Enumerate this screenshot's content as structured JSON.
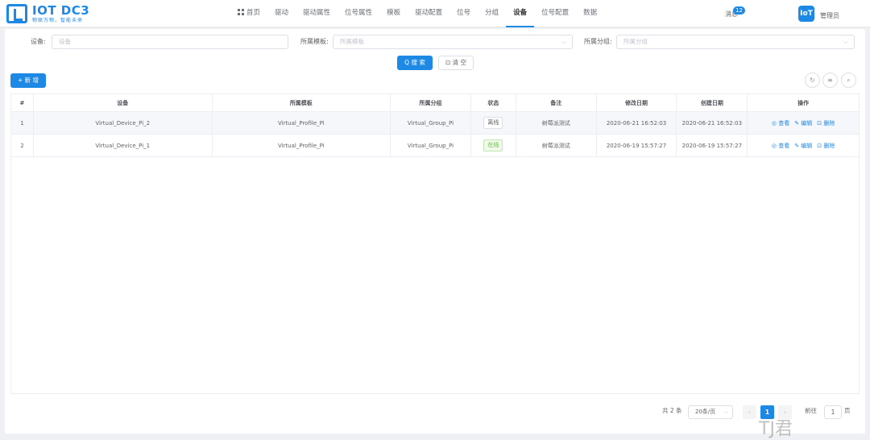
{
  "app": {
    "logo_title": "IOT DC3",
    "logo_subtitle": "物联万物，智能未来"
  },
  "nav": {
    "items": [
      "首页",
      "驱动",
      "驱动属性",
      "位号属性",
      "模板",
      "驱动配置",
      "位号",
      "分组",
      "设备",
      "位号配置",
      "数据"
    ],
    "active": "设备"
  },
  "header": {
    "messages_label": "消息",
    "messages_count": "12",
    "avatar_text": "IoT",
    "user_label": "管理员"
  },
  "filters": {
    "device_label": "设备:",
    "device_placeholder": "设备",
    "template_label": "所属模板:",
    "template_placeholder": "所属模板",
    "group_label": "所属分组:",
    "group_placeholder": "所属分组"
  },
  "actions": {
    "search_label": "Q 搜 索",
    "clear_label": "⊡ 清 空",
    "add_label": "+ 新 增"
  },
  "table": {
    "headers": [
      "#",
      "设备",
      "所属模板",
      "所属分组",
      "状态",
      "备注",
      "修改日期",
      "创建日期",
      "操作"
    ],
    "rows": [
      {
        "index": "1",
        "device": "Virtual_Device_Pi_2",
        "profile": "Virtual_Profile_Pi",
        "group": "Virtual_Group_Pi",
        "status": "离线",
        "status_type": "offline",
        "remark": "树莓派测试",
        "updated": "2020-06-21 16:52:03",
        "created": "2020-06-21 16:52:03"
      },
      {
        "index": "2",
        "device": "Virtual_Device_Pi_1",
        "profile": "Virtual_Profile_Pi",
        "group": "Virtual_Group_Pi",
        "status": "在线",
        "status_type": "online",
        "remark": "树莓派测试",
        "updated": "2020-06-19 15:57:27",
        "created": "2020-06-19 15:57:27"
      }
    ],
    "op_view": "◎ 查看",
    "op_edit": "✎ 编辑",
    "op_delete": "⊡ 删除"
  },
  "pagination": {
    "total_text": "共 2 条",
    "page_size": "20条/页",
    "current_page": "1",
    "goto_label": "前往",
    "goto_value": "1",
    "page_unit": "页"
  },
  "watermark": "TJ君",
  "colors": {
    "primary": "#1e88e5",
    "online": "#67c23a"
  }
}
